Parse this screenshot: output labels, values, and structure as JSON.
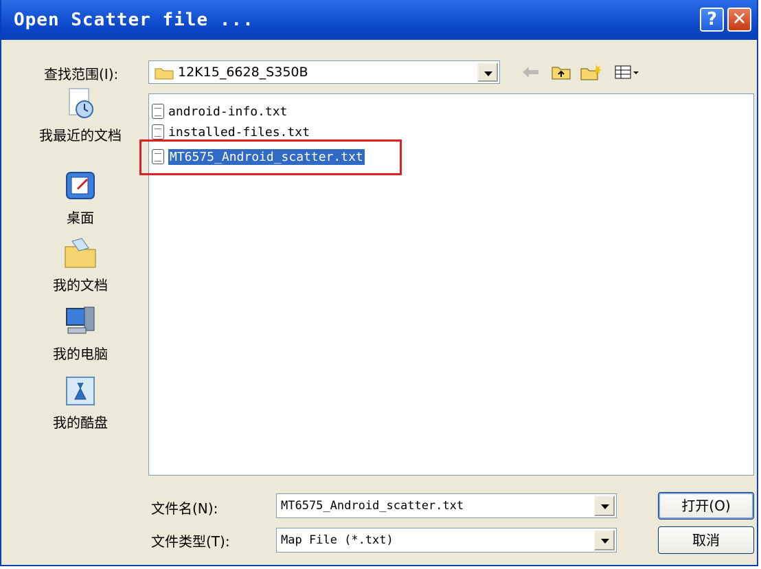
{
  "window": {
    "title": "Open Scatter file ...",
    "help_label": "?",
    "close_label": "✕"
  },
  "lookin": {
    "label": "查找范围(I):",
    "value": "12K15_6628_S350B"
  },
  "toolbar": {
    "back_icon": "back-arrow-icon",
    "up_icon": "up-folder-icon",
    "new_folder_icon": "new-folder-icon",
    "view_icon": "view-menu-icon"
  },
  "places": [
    {
      "label": "我最近的文档",
      "icon": "recent-documents-icon"
    },
    {
      "label": "桌面",
      "icon": "desktop-icon"
    },
    {
      "label": "我的文档",
      "icon": "my-documents-icon"
    },
    {
      "label": "我的电脑",
      "icon": "my-computer-icon"
    },
    {
      "label": "我的酷盘",
      "icon": "kupan-icon"
    }
  ],
  "files": [
    {
      "name": "android-info.txt",
      "selected": false
    },
    {
      "name": "installed-files.txt",
      "selected": false
    },
    {
      "name": "MT6575_Android_scatter.txt",
      "selected": true
    }
  ],
  "filename": {
    "label": "文件名(N):",
    "value": "MT6575_Android_scatter.txt"
  },
  "filetype": {
    "label": "文件类型(T):",
    "value": "Map File (*.txt)"
  },
  "buttons": {
    "open": "打开(O)",
    "cancel": "取消"
  },
  "colors": {
    "title_bar": "#0a47c8",
    "selection": "#316ac5",
    "highlight": "#e02020",
    "dialog_bg": "#ece9d8"
  }
}
